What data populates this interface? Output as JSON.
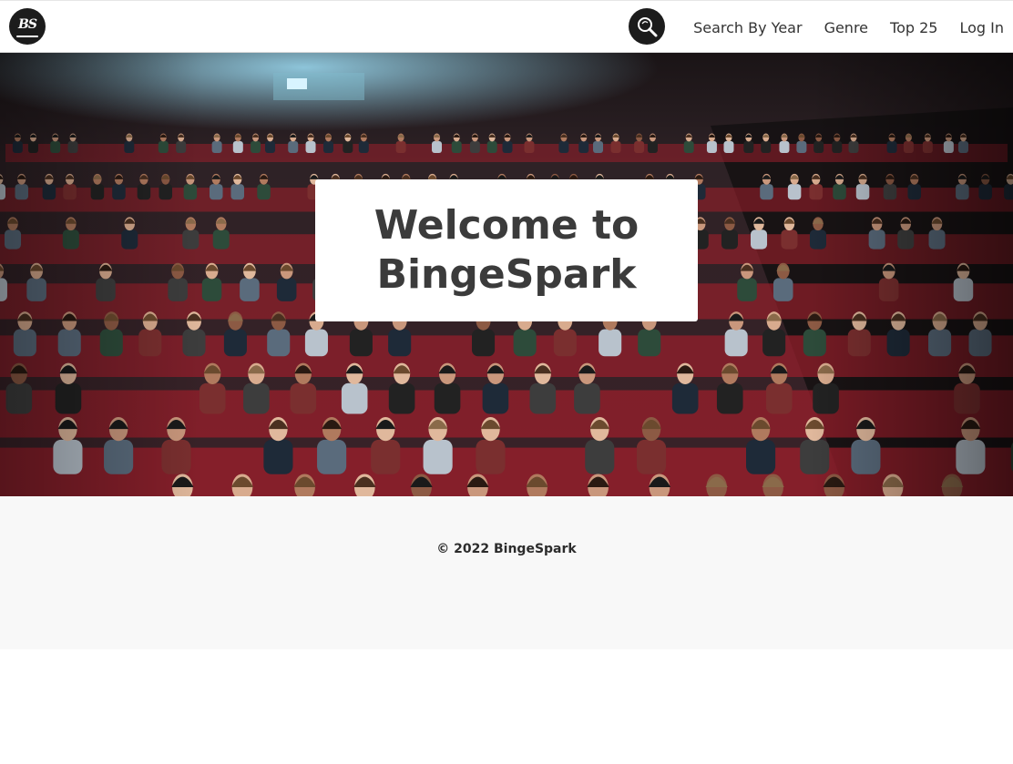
{
  "brand": {
    "logo_text": "BS",
    "logo_icon": "bs-logo-icon"
  },
  "nav": {
    "search_icon": "search-icon",
    "links": [
      "Search By Year",
      "Genre",
      "Top 25",
      "Log In"
    ]
  },
  "hero": {
    "title": "Welcome to BingeSpark",
    "image": "movie-theater-audience-photo"
  },
  "footer": {
    "copyright": "© 2022 BingeSpark"
  },
  "colors": {
    "dark": "#1c1c1c",
    "text": "#333333",
    "footer_bg": "#f8f8f8",
    "seat_red": "#9a1f2b"
  }
}
